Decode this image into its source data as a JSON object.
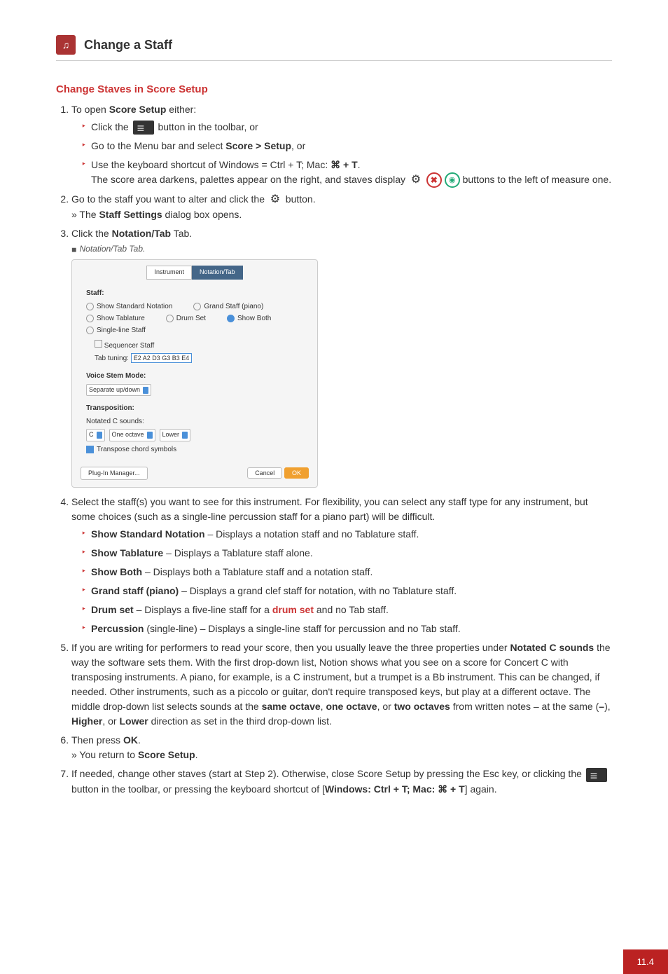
{
  "header": {
    "title": "Change a Staff",
    "icon_alt": "app-icon"
  },
  "section_title": "Change Staves in Score Setup",
  "step1": {
    "intro_a": "To open ",
    "intro_bold": "Score Setup",
    "intro_b": " either:",
    "opt_a_1": "Click the ",
    "opt_a_2": " button in the toolbar, or",
    "opt_b_1": "Go to the Menu bar and select ",
    "opt_b_bold": "Score > Setup",
    "opt_b_2": ", or",
    "opt_c_1": "Use the keyboard shortcut of Windows = Ctrl + T; Mac: ",
    "opt_c_key": "⌘ + T",
    "opt_c_2": ".",
    "result_1": "The score area darkens, palettes appear on the right, and staves display ",
    "result_2": " buttons to the left of measure one."
  },
  "step2": {
    "a1": "Go to the staff you want to alter and click the ",
    "a2": " button.",
    "result_1": "» The ",
    "result_bold": "Staff Settings",
    "result_2": " dialog box opens."
  },
  "step3": {
    "a1": "Click the ",
    "a_bold": "Notation/Tab",
    "a2": " Tab.",
    "caption": "Notation/Tab Tab."
  },
  "dialog": {
    "tab_inactive": "Instrument",
    "tab_active": "Notation/Tab",
    "staff_label": "Staff:",
    "opt_std": "Show Standard Notation",
    "opt_tab": "Show Tablature",
    "opt_both": "Show Both",
    "opt_grand": "Grand Staff (piano)",
    "opt_drum": "Drum Set",
    "opt_single": "Single-line Staff",
    "seq_label": "Sequencer Staff",
    "tab_tuning_label": "Tab tuning:",
    "tab_tuning_value": "E2 A2 D3 G3 B3 E4",
    "voice_label": "Voice Stem Mode:",
    "voice_value": "Separate up/down",
    "trans_label": "Transposition:",
    "trans_sub": "Notated C sounds:",
    "trans_note": "C",
    "trans_oct": "One octave",
    "trans_dir": "Lower",
    "trans_chk": "Transpose chord symbols",
    "btn_plugin": "Plug-In Manager...",
    "btn_cancel": "Cancel",
    "btn_ok": "OK"
  },
  "step4": {
    "intro": "Select the staff(s) you want to see for this instrument. For flexibility, you can select any staff type for any instrument, but some choices (such as a single-line percussion staff for a piano part) will be difficult.",
    "i1_b": "Show Standard Notation",
    "i1_t": " – Displays a notation staff and no Tablature staff.",
    "i2_b": "Show Tablature",
    "i2_t": " – Displays a Tablature staff alone.",
    "i3_b": "Show Both",
    "i3_t": " – Displays both a Tablature staff and a notation staff.",
    "i4_b": "Grand staff (piano)",
    "i4_t": " – Displays a grand clef staff for notation, with no Tablature staff.",
    "i5_b": "Drum set",
    "i5_t1": " – Displays a five-line staff for a ",
    "i5_link": "drum set",
    "i5_t2": " and no Tab staff.",
    "i6_b": "Percussion",
    "i6_t": " (single-line) – Displays a single-line staff for percussion and no Tab staff."
  },
  "step5": {
    "t1": "If you are writing for performers to read your score, then you usually leave the three properties under ",
    "b1": "Notated C sounds",
    "t2": " the way the software sets them. With the first drop-down list, Notion shows what you see on a score for Concert C with transposing instruments. A piano, for example, is a C instrument, but a trumpet is a Bb instrument. This can be changed, if needed. Other instruments, such as a piccolo or guitar, don't require transposed keys, but play at a different octave. The middle drop-down list selects sounds at the ",
    "b2": "same octave",
    "t3": ", ",
    "b3": "one octave",
    "t4": ", or ",
    "b4": "two octaves",
    "t5": " from written notes – at the same (",
    "b5": "–",
    "t6": "), ",
    "b6": "Higher",
    "t7": ", or ",
    "b7": "Lower",
    "t8": " direction as set in the third drop-down list."
  },
  "step6": {
    "t1": "Then press ",
    "b1": "OK",
    "t2": ".",
    "r1": "» You return to ",
    "rb": "Score Setup",
    "r2": "."
  },
  "step7": {
    "t1": "If needed, change other staves (start at Step 2). Otherwise, close Score Setup by pressing the Esc key, or clicking the ",
    "t2": " button in the toolbar, or pressing the keyboard shortcut of [",
    "b1": "Windows: Ctrl + T; Mac: ⌘ + T",
    "t3": "] again."
  },
  "page_number": "11.4"
}
